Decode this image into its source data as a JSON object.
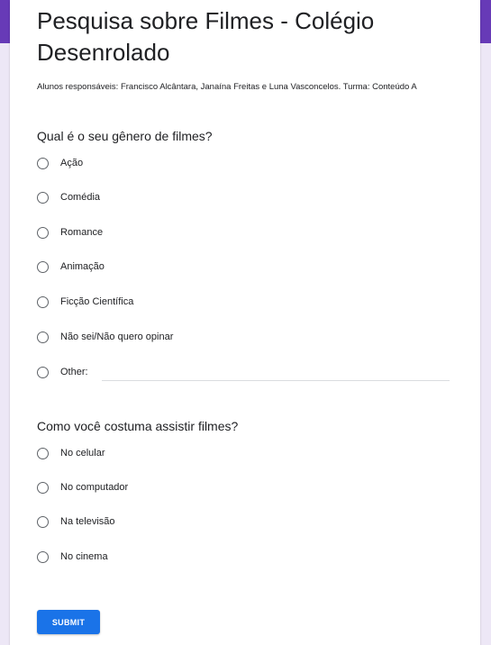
{
  "form": {
    "title": "Pesquisa sobre Filmes - Colégio Desenrolado",
    "description": "Alunos responsáveis: Francisco Alcântara, Janaína Freitas e Luna Vasconcelos. Turma: Conteúdo A"
  },
  "questions": [
    {
      "title": "Qual é o seu gênero de filmes?",
      "options": [
        "Ação",
        "Comédia",
        "Romance",
        "Animação",
        "Ficção Científica",
        "Não sei/Não quero opinar",
        "Other:"
      ]
    },
    {
      "title": "Como você costuma assistir filmes?",
      "options": [
        "No celular",
        "No computador",
        "Na televisão",
        "No cinema"
      ]
    }
  ],
  "submit_label": "SUBMIT",
  "colors": {
    "header": "#673ab7",
    "page_background": "#ede7f6",
    "submit": "#1a73e8"
  }
}
